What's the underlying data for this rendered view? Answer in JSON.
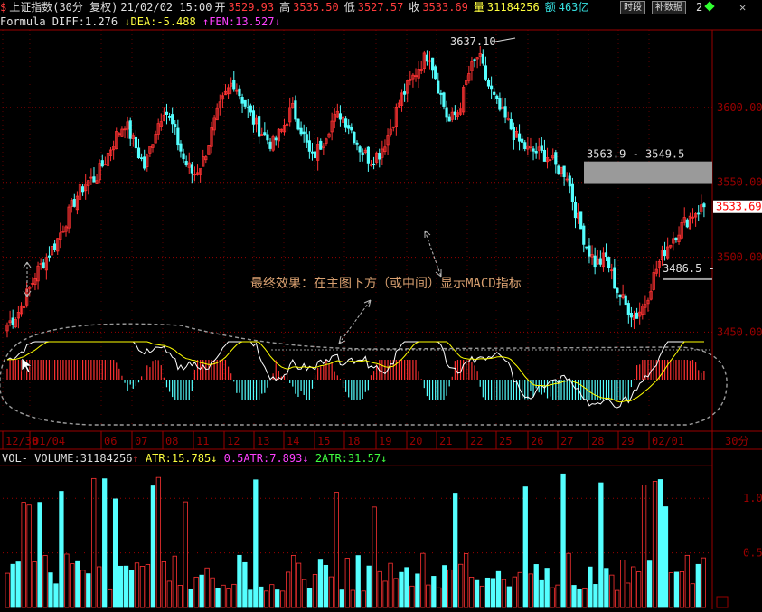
{
  "header": {
    "dollar_icon": "$",
    "name": "上证指数(30分 复权)",
    "datetime": "21/02/02 15:00",
    "open_label": "开",
    "open": "3529.93",
    "high_label": "高",
    "high": "3535.50",
    "low_label": "低",
    "low": "3527.57",
    "close_label": "收",
    "close": "3533.69",
    "volume_label": "量",
    "volume": "31184256",
    "amount_label": "额",
    "amount": "463亿",
    "btn_period": "时段",
    "btn_data": "补数据",
    "extra": "2"
  },
  "macd_legend": {
    "formula": "Formula DIFF:1.276",
    "dea": "DEA:-5.488",
    "fen": "FEN:13.527"
  },
  "vol_legend": {
    "vol": "VOL- VOLUME:31184256",
    "atr": "ATR:15.785",
    "half_atr": "0.5ATR:7.893",
    "double_atr": "2ATR:31.57"
  },
  "colors": {
    "up": "#ff3232",
    "down": "#54ffff",
    "grid": "#9a0000",
    "diff": "#ffffff",
    "dea": "#ffff00",
    "annot": "#d8a070"
  },
  "chart_data": {
    "type": "candlestick",
    "title": "上证指数(30分 复权)",
    "ylim": [
      3440,
      3650
    ],
    "y_ticks": [
      3450,
      3500,
      3550,
      3600
    ],
    "y_tick_labels": [
      "3450.00",
      "3500.00",
      "3550.00",
      "3600.00"
    ],
    "last_price": "3533.69",
    "x_tick_labels": [
      "12/30",
      "01/04",
      "06",
      "07",
      "08",
      "11",
      "12",
      "13",
      "14",
      "15",
      "18",
      "19",
      "20",
      "21",
      "22",
      "25",
      "26",
      "27",
      "28",
      "29",
      "02/01"
    ],
    "period_label": "30分",
    "price_path": [
      3455,
      3462,
      3475,
      3490,
      3500,
      3510,
      3525,
      3540,
      3550,
      3553,
      3565,
      3580,
      3590,
      3575,
      3560,
      3583,
      3600,
      3585,
      3565,
      3555,
      3565,
      3588,
      3605,
      3618,
      3605,
      3592,
      3583,
      3575,
      3585,
      3600,
      3585,
      3565,
      3576,
      3590,
      3596,
      3586,
      3572,
      3565,
      3570,
      3585,
      3605,
      3616,
      3628,
      3637,
      3612,
      3590,
      3598,
      3622,
      3635,
      3615,
      3600,
      3590,
      3578,
      3572,
      3570,
      3568,
      3560,
      3556,
      3528,
      3508,
      3495,
      3500,
      3480,
      3468,
      3460,
      3470,
      3490,
      3505,
      3515,
      3523,
      3530,
      3533.69
    ],
    "annotations": [
      "3637.10",
      "3563.9 - 3549.5",
      "3486.5 -"
    ],
    "note": "最终效果：在主图下方（或中间）显示MACD指标",
    "macd": {
      "diff_label": "DIFF",
      "diff": 1.276,
      "dea_label": "DEA",
      "dea": -5.488,
      "fen_label": "FEN",
      "fen": 13.527
    },
    "volume": {
      "y_tick_labels": [
        "0.5",
        "1.0"
      ],
      "last": 31184256,
      "atr": 15.785,
      "half_atr": 7.893,
      "double_atr": 31.57
    }
  }
}
